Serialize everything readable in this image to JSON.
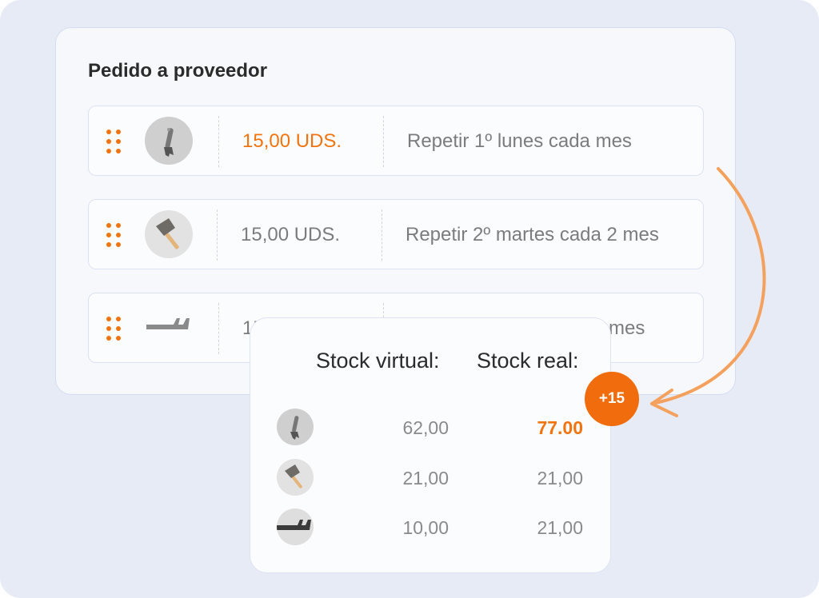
{
  "order": {
    "title": "Pedido a proveedor",
    "rows": [
      {
        "icon": "adjustable-wrench-icon",
        "quantity": "15,00 UDS.",
        "highlighted": true,
        "repeat": "Repetir 1º lunes cada mes"
      },
      {
        "icon": "axe-icon",
        "quantity": "15,00 UDS.",
        "highlighted": false,
        "repeat": "Repetir 2º martes cada 2 mes"
      },
      {
        "icon": "open-wrench-icon",
        "quantity": "15",
        "highlighted": false,
        "repeat": "mes"
      }
    ]
  },
  "stock": {
    "virtual_header": "Stock virtual:",
    "real_header": "Stock real:",
    "rows": [
      {
        "icon": "adjustable-wrench-icon",
        "virtual": "62,00",
        "real": "77.00",
        "highlighted": true
      },
      {
        "icon": "axe-icon",
        "virtual": "21,00",
        "real": "21,00",
        "highlighted": false
      },
      {
        "icon": "open-wrench-icon",
        "virtual": "10,00",
        "real": "21,00",
        "highlighted": false
      }
    ],
    "badge": "+15"
  },
  "colors": {
    "accent": "#f07410",
    "background": "#e6ebf6",
    "card": "#f7f8fc",
    "muted_text": "#7c7c7c"
  }
}
